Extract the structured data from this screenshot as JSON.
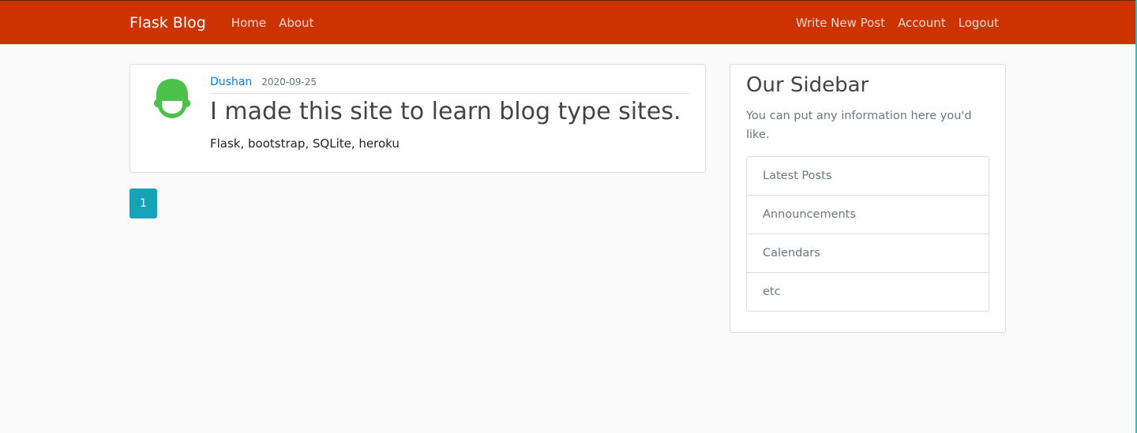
{
  "navbar": {
    "brand": "Flask Blog",
    "left_links": [
      "Home",
      "About"
    ],
    "right_links": [
      "Write New Post",
      "Account",
      "Logout"
    ],
    "background_color": "#cc3300"
  },
  "post": {
    "author": "Dushan",
    "date": "2020-09-25",
    "title": "I made this site to learn blog type sites.",
    "content": "Flask, bootstrap, SQLite, heroku",
    "avatar_icon": "user-helmet-icon",
    "avatar_color": "#4cc24c"
  },
  "pagination": {
    "pages": [
      "1"
    ],
    "active_color": "#17a2b8"
  },
  "sidebar": {
    "title": "Our Sidebar",
    "description": "You can put any information here you'd like.",
    "items": [
      "Latest Posts",
      "Announcements",
      "Calendars",
      "etc"
    ]
  }
}
